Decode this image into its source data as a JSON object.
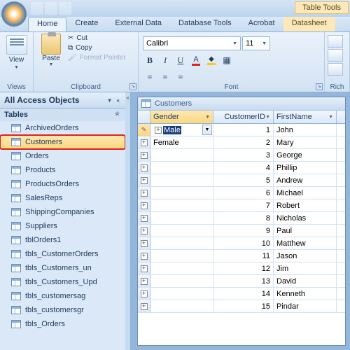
{
  "context_tab": "Table Tools",
  "ribbon": {
    "tabs": [
      "Home",
      "Create",
      "External Data",
      "Database Tools",
      "Acrobat",
      "Datasheet"
    ],
    "active_tab": "Home",
    "views_label": "View",
    "views_group": "Views",
    "clipboard": {
      "paste": "Paste",
      "cut": "Cut",
      "copy": "Copy",
      "format_painter": "Format Painter",
      "group": "Clipboard"
    },
    "font": {
      "name": "Calibri",
      "size": "11",
      "group": "Font"
    },
    "rich_group": "Rich"
  },
  "nav": {
    "header": "All Access Objects",
    "group": "Tables",
    "items": [
      "ArchivedOrders",
      "Customers",
      "Orders",
      "Products",
      "ProductsOrders",
      "SalesReps",
      "ShippingCompanies",
      "Suppliers",
      "tblOrders1",
      "tbls_CustomerOrders",
      "tbls_Customers_un",
      "tbls_Customers_Upd",
      "tbls_customersag",
      "tbls_customersgr",
      "tbls_Orders"
    ],
    "selected": "Customers"
  },
  "datasheet": {
    "title": "Customers",
    "columns": [
      "Gender",
      "CustomerID",
      "FirstName"
    ],
    "rows": [
      {
        "gender": "Male",
        "id": 1,
        "fname": "John",
        "editing": true
      },
      {
        "gender": "Female",
        "id": 2,
        "fname": "Mary"
      },
      {
        "gender": "",
        "id": 3,
        "fname": "George"
      },
      {
        "gender": "",
        "id": 4,
        "fname": "Phillip"
      },
      {
        "gender": "",
        "id": 5,
        "fname": "Andrew"
      },
      {
        "gender": "",
        "id": 6,
        "fname": "Michael"
      },
      {
        "gender": "",
        "id": 7,
        "fname": "Robert"
      },
      {
        "gender": "",
        "id": 8,
        "fname": "Nicholas"
      },
      {
        "gender": "",
        "id": 9,
        "fname": "Paul"
      },
      {
        "gender": "",
        "id": 10,
        "fname": "Matthew"
      },
      {
        "gender": "",
        "id": 11,
        "fname": "Jason"
      },
      {
        "gender": "",
        "id": 12,
        "fname": "Jim"
      },
      {
        "gender": "",
        "id": 13,
        "fname": "David"
      },
      {
        "gender": "",
        "id": 14,
        "fname": "Kenneth"
      },
      {
        "gender": "",
        "id": 15,
        "fname": "Pindar"
      }
    ]
  }
}
